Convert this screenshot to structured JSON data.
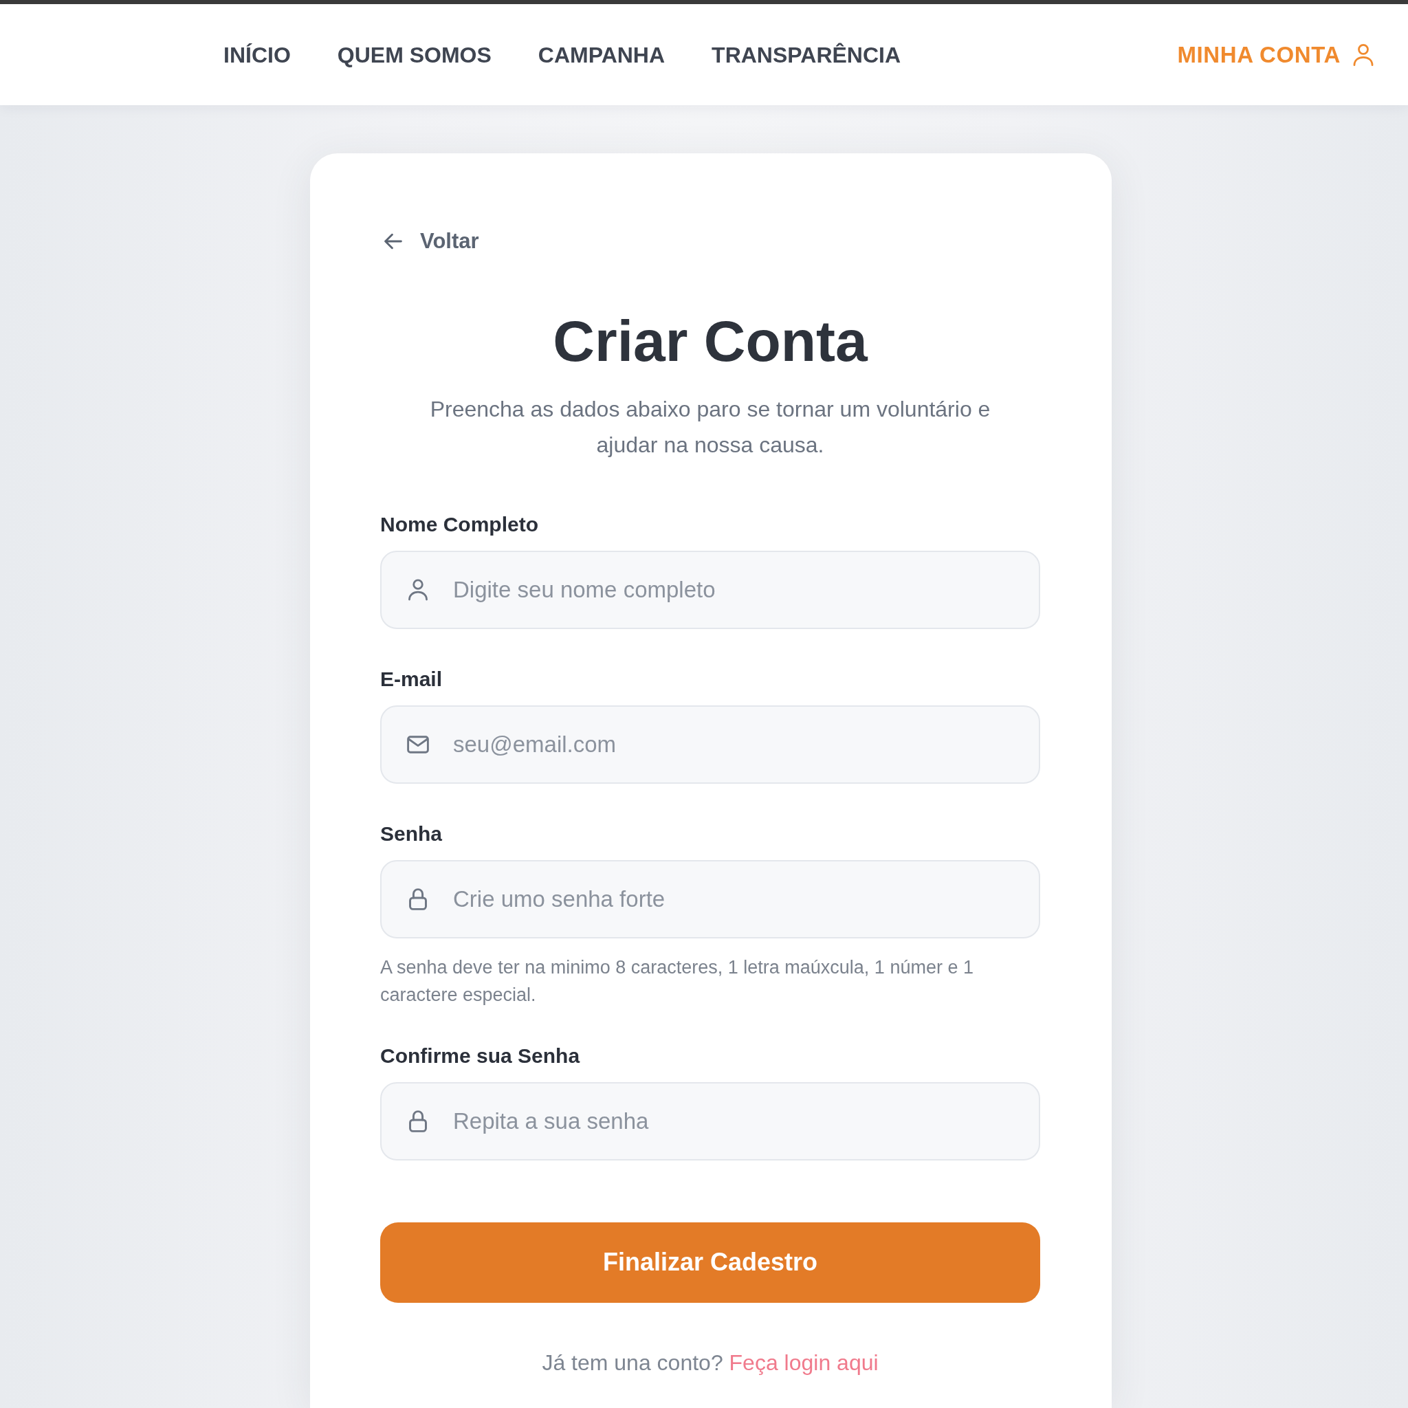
{
  "nav": {
    "items": [
      {
        "label": "INÍCIO"
      },
      {
        "label": "QUEM SOMOS"
      },
      {
        "label": "CAMPANHA"
      },
      {
        "label": "TRANSPARÊNCIA"
      }
    ],
    "account_link": {
      "label": "MINHA CONTA"
    }
  },
  "back_link": {
    "label": "Voltar"
  },
  "form": {
    "title": "Criar Conta",
    "subtitle": "Preencha as dados abaixo paro se tornar um voluntário e ajudar na nossa causa.",
    "fields": [
      {
        "kind": "text",
        "label": "Nome Completo",
        "placeholder": "Digite seu nome completo"
      },
      {
        "kind": "email",
        "label": "E-mail",
        "placeholder": "seu@email.com"
      },
      {
        "kind": "password",
        "label": "Senha",
        "placeholder": "Crie umo senha forte",
        "hint": "A senha deve ter na minimo 8 caracteres, 1 letra maúxcula, 1 númer e 1 caractere especial."
      },
      {
        "kind": "password",
        "label": "Confirme sua Senha",
        "placeholder": "Repita a sua senha"
      }
    ],
    "submit_button": "Finalizar Cadestro",
    "login_prompt": {
      "text": "Já tem una conto?",
      "link": "Feça login aqui"
    }
  }
}
